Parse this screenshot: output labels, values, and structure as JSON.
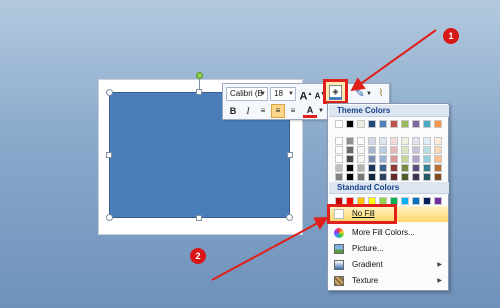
{
  "mini_toolbar": {
    "font_name": "Calibri (B",
    "font_size": "18",
    "grow_font": "A",
    "shrink_font": "A",
    "bold": "B",
    "italic": "I",
    "font_color": "A"
  },
  "fill_menu": {
    "theme_colors_header": "Theme Colors",
    "standard_colors_header": "Standard Colors",
    "no_fill": "No Fill",
    "more_fill_colors": "More Fill Colors...",
    "picture": "Picture...",
    "gradient": "Gradient",
    "texture": "Texture"
  },
  "annotations": {
    "step1": "1",
    "step2": "2"
  },
  "colors": {
    "shape_fill": "#4a7ebb",
    "highlight": "#e0201a",
    "theme_top": [
      "#ffffff",
      "#000000",
      "#eeece1",
      "#1f497d",
      "#4f81bd",
      "#c0504d",
      "#9bbb59",
      "#8064a2",
      "#4bacc6",
      "#f79646"
    ],
    "standard": [
      "#c00000",
      "#ff0000",
      "#ffc000",
      "#ffff00",
      "#92d050",
      "#00b050",
      "#00b0f0",
      "#0070c0",
      "#002060",
      "#7030a0"
    ]
  },
  "icons": {
    "fill": "paint-bucket-icon",
    "line": "pen-icon",
    "effects": "brush-icon"
  }
}
